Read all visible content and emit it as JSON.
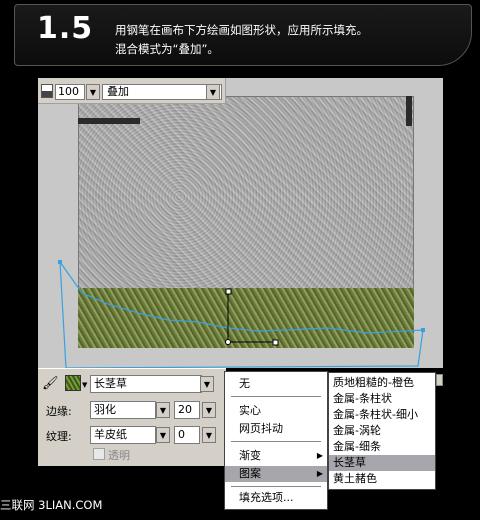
{
  "banner": {
    "step": "1.5",
    "instruction_line1": "用钢笔在画布下方绘画如图形状，应用所示填充。",
    "instruction_line2": "混合模式为“叠加”。"
  },
  "toolbar": {
    "opacity_value": "100",
    "blend_mode": "叠加"
  },
  "props": {
    "fill_pattern": "长茎草",
    "edge_label": "边缘:",
    "edge_value": "羽化",
    "edge_amount": "20",
    "texture_label": "纹理:",
    "texture_value": "羊皮纸",
    "texture_amount": "0",
    "transparent_label": "透明"
  },
  "menu": {
    "items": [
      "无",
      "实心",
      "网页抖动",
      "渐变",
      "图案",
      "填充选项..."
    ]
  },
  "submenu": {
    "items": [
      "质地粗糙的-橙色",
      "金属-条柱状",
      "金属-条柱状-细小",
      "金属-涡轮",
      "金属-细条",
      "长茎草",
      "黄土赭色"
    ],
    "selected": "长茎草"
  },
  "footer": {
    "watermark": "三联网 3LIAN.COM"
  }
}
